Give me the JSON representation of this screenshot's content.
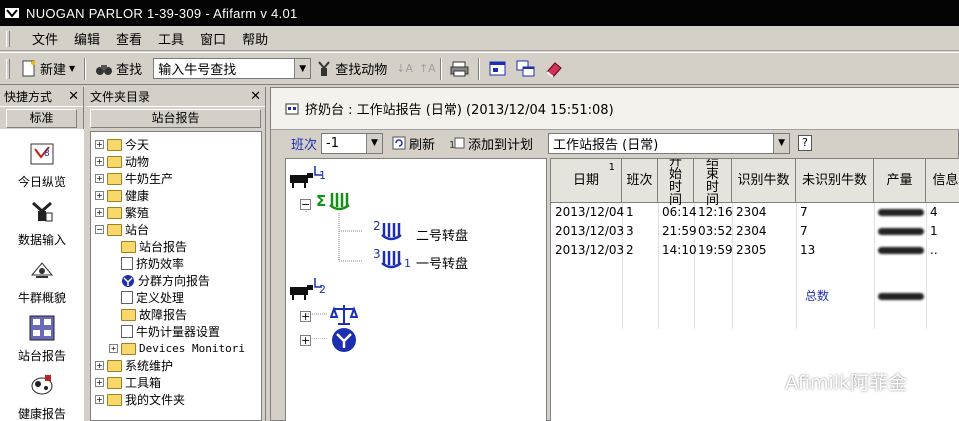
{
  "window": {
    "title": "NUOGAN PARLOR 1-39-309 - Afifarm v 4.01"
  },
  "menu": [
    "文件",
    "编辑",
    "查看",
    "工具",
    "窗口",
    "帮助"
  ],
  "toolbar": {
    "new_label": "新建",
    "find_label": "查找",
    "cow_search_value": "输入牛号查找",
    "find_animal_label": "查找动物"
  },
  "shortcuts": {
    "header": "快捷方式",
    "tab": "标准",
    "items": [
      "今日纵览",
      "数据输入",
      "牛群概貌",
      "站台报告",
      "健康报告"
    ]
  },
  "folders": {
    "header": "文件夹目录",
    "tab": "站台报告",
    "tree": [
      "今天",
      "动物",
      "牛奶生产",
      "健康",
      "繁殖",
      "站台",
      "站台报告",
      "挤奶效率",
      "分群方向报告",
      "定义处理",
      "故障报告",
      "牛奶计量器设置",
      "Devices Monitori",
      "系统维护",
      "工具箱",
      "我的文件夹"
    ]
  },
  "report": {
    "window_title": "挤奶台 : 工作站报告 (日常) (2013/12/04 15:51:08)",
    "shift_label": "班次",
    "shift_value": "-1",
    "refresh_label": "刷新",
    "add_plan_label": "添加到计划",
    "report_select": "工作站报告 (日常)",
    "help_q": "?",
    "tree": {
      "group1_num": "1",
      "group2_num": "2",
      "sigma": "Σ",
      "turntable2_num": "2",
      "turntable2_label": "二号转盘",
      "turntable1_num": "3",
      "turntable1_sub": "1",
      "turntable1_label": "一号转盘"
    },
    "table": {
      "sort_mark": "1",
      "headers": [
        "日期",
        "班次",
        "开始时间",
        "结束时间",
        "识别牛数",
        "未识别牛数",
        "产量",
        "信息"
      ],
      "rows": [
        [
          "2013/12/04",
          "1",
          "06:14",
          "12:16",
          "2304",
          "7",
          "4"
        ],
        [
          "2013/12/03",
          "3",
          "21:59",
          "03:52",
          "2304",
          "7",
          "1"
        ],
        [
          "2013/12/03",
          "2",
          "14:10",
          "19:59",
          "2305",
          "13",
          ".."
        ]
      ],
      "total_label": "总数"
    }
  },
  "watermark": "Afimilk阿菲金",
  "colors": {
    "icon_blue": "#1c2fb0",
    "icon_green": "#149014",
    "titlebar": "#040404"
  }
}
